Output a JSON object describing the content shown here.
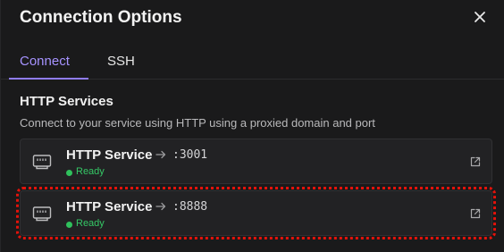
{
  "dialog": {
    "title": "Connection Options"
  },
  "tabs": [
    {
      "label": "Connect",
      "active": true
    },
    {
      "label": "SSH",
      "active": false
    }
  ],
  "section": {
    "title": "HTTP Services",
    "description": "Connect to your service using HTTP using a proxied domain and port"
  },
  "services": [
    {
      "name": "HTTP Service",
      "port": ":3001",
      "status": "Ready",
      "icon": "ethernet-port-icon"
    },
    {
      "name": "HTTP Service",
      "port": ":8888",
      "status": "Ready",
      "icon": "ethernet-port-icon",
      "highlighted": true
    }
  ],
  "colors": {
    "background": "#1a1a1b",
    "card": "#222224",
    "accent": "#a693ff",
    "ready": "#2fc15c",
    "highlight": "#e3120b"
  }
}
